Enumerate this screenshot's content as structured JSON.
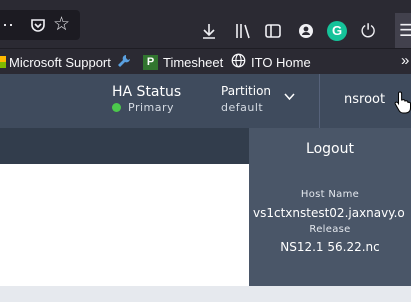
{
  "toolbar": {
    "overflow_icon": "⋯",
    "pocket_icon": "pocket-icon",
    "star_icon": "☆",
    "download_icon": "download-icon",
    "library_icon": "library-icon",
    "sidebar_icon": "sidebar-icon",
    "account_icon": "account-icon",
    "grammarly_label": "G",
    "power_icon": "⏻",
    "menu_icon": "☰"
  },
  "bookmarks": {
    "items": [
      {
        "label": "Microsoft Support",
        "icon": "ms-logo-icon"
      },
      {
        "label": "",
        "icon": "wrench-icon"
      },
      {
        "label": "Timesheet",
        "icon": "project-icon",
        "icon_text": "P"
      },
      {
        "label": "ITO Home",
        "icon": "globe-icon"
      }
    ],
    "overflow": "»"
  },
  "header": {
    "ha_status_title": "HA Status",
    "ha_status_value": "Primary",
    "partition_title": "Partition",
    "partition_value": "default",
    "user_name": "nsroot"
  },
  "user_menu": {
    "logout_label": "Logout",
    "host_name_label": "Host Name",
    "host_name_value": "vs1ctxnstest02.jaxnavy.o",
    "release_label": "Release",
    "release_value": "NS12.1 56.22.nc"
  },
  "colors": {
    "browser_bg": "#2b2a33",
    "header_bg": "#3f4b5d",
    "dropdown_bg": "#4a5668",
    "status_green": "#4cc94c",
    "grammarly_green": "#15c39a"
  }
}
